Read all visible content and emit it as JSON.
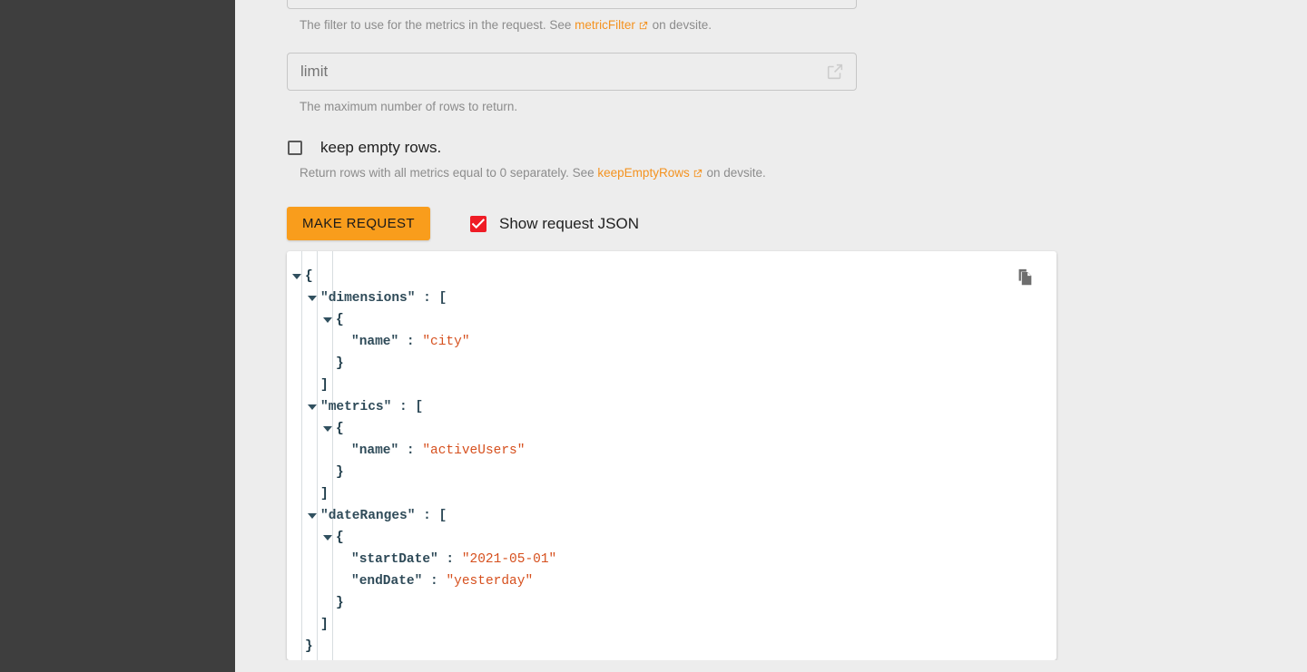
{
  "sidebar": {
    "label": "navigation-panel"
  },
  "fields": {
    "filter": {
      "name": "metric-filter-field",
      "value": "",
      "helper_prefix": "The filter to use for the metrics in the request. See ",
      "helper_link": "metricFilter",
      "helper_suffix": " on devsite.",
      "link_icon": "external-link-icon"
    },
    "limit": {
      "label": "limit",
      "placeholder": "limit",
      "value": "",
      "launch_icon": "open-in-new-icon",
      "helper": "The maximum number of rows to return."
    }
  },
  "keep_empty_rows": {
    "label": "keep empty rows.",
    "checked": false,
    "helper_prefix": "Return rows with all metrics equal to 0 separately. See ",
    "helper_link": "keepEmptyRows",
    "helper_suffix": " on devsite."
  },
  "actions": {
    "make_request_label": "MAKE REQUEST",
    "show_json_label": "Show request JSON",
    "show_json_checked": true
  },
  "json_viewer": {
    "copy_icon": "copy-icon",
    "lines": [
      {
        "indent": 0,
        "caret": true,
        "text": "{"
      },
      {
        "indent": 1,
        "caret": true,
        "key": "\"dimensions\"",
        "punct": " : ["
      },
      {
        "indent": 2,
        "caret": true,
        "text": "{"
      },
      {
        "indent": 3,
        "caret": false,
        "key": "\"name\"",
        "punct": " : ",
        "value": "\"city\""
      },
      {
        "indent": 2,
        "caret": false,
        "text": "}"
      },
      {
        "indent": 1,
        "caret": false,
        "text": "]"
      },
      {
        "indent": 1,
        "caret": true,
        "key": "\"metrics\"",
        "punct": " : ["
      },
      {
        "indent": 2,
        "caret": true,
        "text": "{"
      },
      {
        "indent": 3,
        "caret": false,
        "key": "\"name\"",
        "punct": " : ",
        "value": "\"activeUsers\""
      },
      {
        "indent": 2,
        "caret": false,
        "text": "}"
      },
      {
        "indent": 1,
        "caret": false,
        "text": "]"
      },
      {
        "indent": 1,
        "caret": true,
        "key": "\"dateRanges\"",
        "punct": " : ["
      },
      {
        "indent": 2,
        "caret": true,
        "text": "{"
      },
      {
        "indent": 3,
        "caret": false,
        "key": "\"startDate\"",
        "punct": " : ",
        "value": "\"2021-05-01\""
      },
      {
        "indent": 3,
        "caret": false,
        "key": "\"endDate\"",
        "punct": " : ",
        "value": "\"yesterday\""
      },
      {
        "indent": 2,
        "caret": false,
        "text": "}"
      },
      {
        "indent": 1,
        "caret": false,
        "text": "]"
      },
      {
        "indent": 0,
        "caret": false,
        "text": "}"
      }
    ],
    "guides": [
      1,
      2,
      3
    ]
  },
  "colors": {
    "sidebar": "#3e3e3e",
    "page_bg": "#ededed",
    "accent_orange": "#f99d1c",
    "link_orange": "#f4921f",
    "checkbox_red": "#ef1c25",
    "json_key": "#2e4a58",
    "json_value": "#d6501e"
  }
}
